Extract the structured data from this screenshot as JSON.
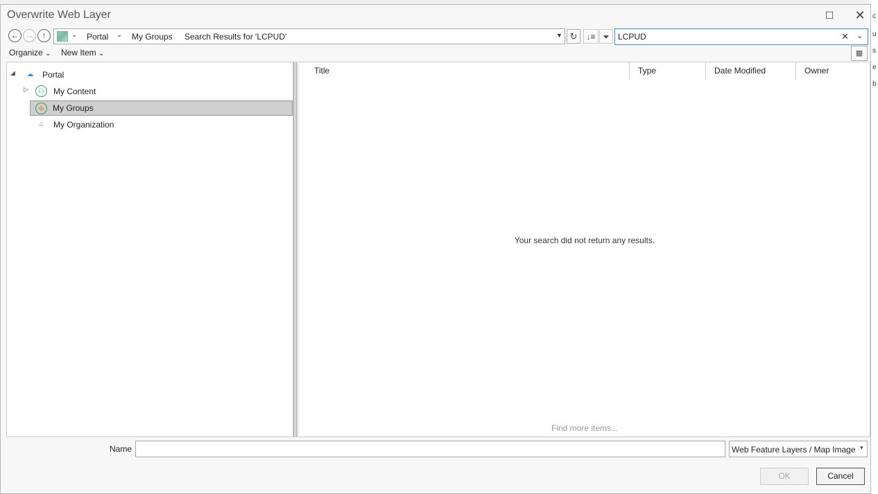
{
  "window": {
    "title": "Overwrite Web Layer",
    "maximize_icon": "maximize-icon",
    "close_icon": "close-icon"
  },
  "nav": {
    "back_icon": "back-arrow-icon",
    "forward_icon": "forward-arrow-icon",
    "up_icon": "up-arrow-icon",
    "breadcrumbs": [
      "Portal",
      "My Groups",
      "Search Results for 'LCPUD'"
    ],
    "refresh_icon": "refresh-icon",
    "sort_icon": "sort-icon",
    "filter_icon": "filter-icon"
  },
  "search": {
    "value": "LCPUD"
  },
  "menu": {
    "organize": "Organize",
    "new_item": "New Item"
  },
  "tree": [
    {
      "label": "Portal",
      "icon": "portal-cloud-icon"
    },
    {
      "label": "My Content",
      "icon": "my-content-icon"
    },
    {
      "label": "My Groups",
      "icon": "my-groups-icon",
      "selected": true
    },
    {
      "label": "My Organization",
      "icon": "my-organization-icon"
    }
  ],
  "list": {
    "columns": [
      "Title",
      "Type",
      "Date Modified",
      "Owner"
    ],
    "empty_message": "Your search did not return any results.",
    "find_more": "Find more items..."
  },
  "footer": {
    "name_label": "Name",
    "name_value": "",
    "type_filter": "Web Feature Layers / Map Image Layers",
    "ok_label": "OK",
    "cancel_label": "Cancel"
  },
  "colors": {
    "accent": "#3b8fd6",
    "selected_bg": "#cfcfcf"
  }
}
